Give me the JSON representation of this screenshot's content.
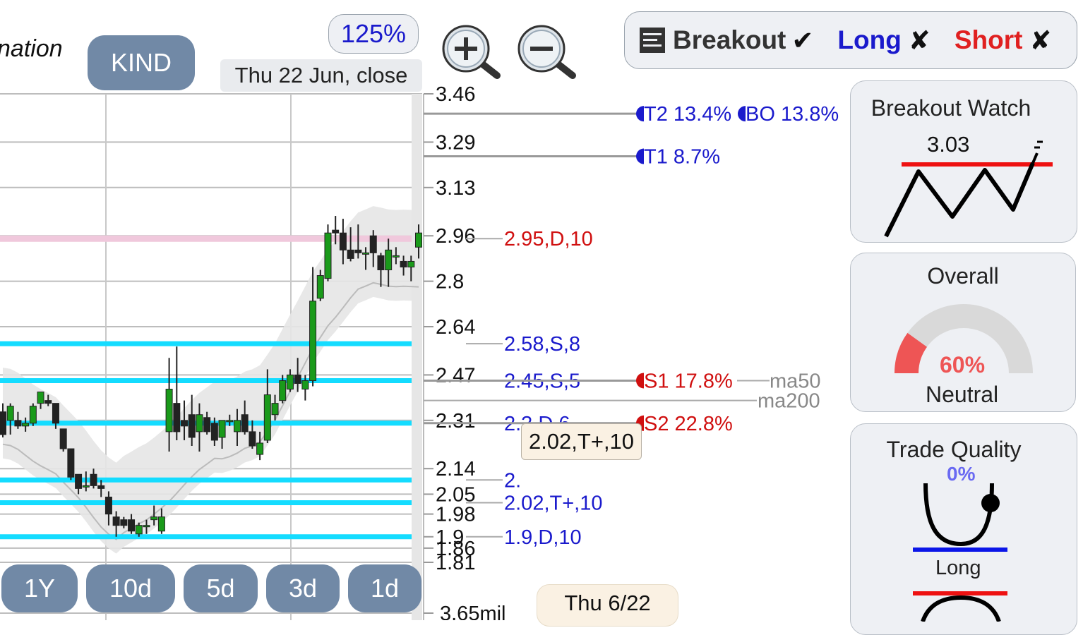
{
  "header": {
    "pattern_fragment": "nation",
    "ticker": "KIND",
    "zoom": "125%",
    "date_label": "Thu 22 Jun, close",
    "zoom_in_icon": "zoom-in-icon",
    "zoom_out_icon": "zoom-out-icon"
  },
  "mode_bar": {
    "icon": "document-icon",
    "breakout_label": "Breakout",
    "breakout_mark": "✔",
    "long_label": "Long",
    "long_mark": "✘",
    "short_label": "Short",
    "short_mark": "✘",
    "colors": {
      "long": "#1a1acc",
      "short": "#e02020"
    }
  },
  "periods": [
    "1Y",
    "10d",
    "5d",
    "3d",
    "1d"
  ],
  "tooltip": "2.02,T+,10",
  "date_box": "Thu 6/22",
  "panels": {
    "breakout_watch": {
      "title": "Breakout Watch",
      "value": "3.03"
    },
    "overall": {
      "title": "Overall",
      "value": "60%",
      "label": "Neutral",
      "fraction": 0.6
    },
    "trade_quality": {
      "title": "Trade Quality",
      "value": "0%",
      "label": "Long"
    }
  },
  "chart_data": {
    "type": "candlestick",
    "ylim": [
      1.78,
      3.5
    ],
    "price_ticks": [
      3.46,
      3.29,
      3.13,
      2.96,
      2.8,
      2.64,
      2.47,
      2.31,
      2.14,
      2.05,
      1.98,
      1.9,
      1.86,
      1.81
    ],
    "volume_label": "3.65mil",
    "resistance_line": 2.95,
    "support_bands": [
      2.58,
      2.45,
      2.3,
      2.1,
      2.02,
      1.9
    ],
    "level_labels": [
      {
        "price": 2.95,
        "text": "2.95,D,10",
        "color": "#d01010"
      },
      {
        "price": 2.58,
        "text": "2.58,S,8",
        "color": "#1a1acc"
      },
      {
        "price": 2.45,
        "text": "2.45,S,5",
        "color": "#1a1acc"
      },
      {
        "price": 2.3,
        "text": "2.3,D,6",
        "color": "#1a1acc"
      },
      {
        "price": 2.1,
        "text": "2.",
        "color": "#1a1acc"
      },
      {
        "price": 2.02,
        "text": "2.02,T+,10",
        "color": "#1a1acc"
      },
      {
        "price": 1.9,
        "text": "1.9,D,10",
        "color": "#1a1acc"
      }
    ],
    "targets": [
      {
        "price": 3.39,
        "text": "T2 13.4%",
        "color": "#1a1acc"
      },
      {
        "price": 3.39,
        "text": "BO 13.8%",
        "color": "#1a1acc"
      },
      {
        "price": 3.24,
        "text": "T1 8.7%",
        "color": "#1a1acc"
      },
      {
        "price": 2.45,
        "text": "S1 17.8%",
        "color": "#d01010"
      },
      {
        "price": 2.3,
        "text": "S2 22.8%",
        "color": "#d01010"
      }
    ],
    "moving_averages": [
      {
        "name": "ma50",
        "price": 2.45
      },
      {
        "name": "ma200",
        "price": 2.38
      }
    ],
    "candles": [
      {
        "o": 2.34,
        "h": 2.37,
        "l": 2.25,
        "c": 2.26
      },
      {
        "o": 2.31,
        "h": 2.37,
        "l": 2.26,
        "c": 2.36
      },
      {
        "o": 2.31,
        "h": 2.34,
        "l": 2.28,
        "c": 2.29
      },
      {
        "o": 2.29,
        "h": 2.32,
        "l": 2.27,
        "c": 2.3
      },
      {
        "o": 2.3,
        "h": 2.37,
        "l": 2.29,
        "c": 2.36
      },
      {
        "o": 2.37,
        "h": 2.41,
        "l": 2.35,
        "c": 2.41
      },
      {
        "o": 2.38,
        "h": 2.4,
        "l": 2.36,
        "c": 2.37
      },
      {
        "o": 2.37,
        "h": 2.37,
        "l": 2.28,
        "c": 2.3
      },
      {
        "o": 2.28,
        "h": 2.28,
        "l": 2.2,
        "c": 2.21
      },
      {
        "o": 2.21,
        "h": 2.21,
        "l": 2.1,
        "c": 2.11
      },
      {
        "o": 2.12,
        "h": 2.12,
        "l": 2.05,
        "c": 2.07
      },
      {
        "o": 2.08,
        "h": 2.13,
        "l": 2.06,
        "c": 2.08
      },
      {
        "o": 2.12,
        "h": 2.14,
        "l": 2.07,
        "c": 2.08
      },
      {
        "o": 2.08,
        "h": 2.1,
        "l": 2.04,
        "c": 2.07
      },
      {
        "o": 2.04,
        "h": 2.06,
        "l": 1.94,
        "c": 1.98
      },
      {
        "o": 1.97,
        "h": 1.99,
        "l": 1.9,
        "c": 1.94
      },
      {
        "o": 1.96,
        "h": 1.97,
        "l": 1.93,
        "c": 1.94
      },
      {
        "o": 1.96,
        "h": 1.98,
        "l": 1.91,
        "c": 1.92
      },
      {
        "o": 1.91,
        "h": 1.95,
        "l": 1.9,
        "c": 1.94
      },
      {
        "o": 1.94,
        "h": 1.96,
        "l": 1.91,
        "c": 1.94
      },
      {
        "o": 1.96,
        "h": 2.01,
        "l": 1.94,
        "c": 1.97
      },
      {
        "o": 1.92,
        "h": 2.0,
        "l": 1.91,
        "c": 1.97
      },
      {
        "o": 2.27,
        "h": 2.53,
        "l": 2.2,
        "c": 2.42
      },
      {
        "o": 2.37,
        "h": 2.57,
        "l": 2.24,
        "c": 2.27
      },
      {
        "o": 2.31,
        "h": 2.38,
        "l": 2.24,
        "c": 2.29
      },
      {
        "o": 2.33,
        "h": 2.4,
        "l": 2.22,
        "c": 2.25
      },
      {
        "o": 2.27,
        "h": 2.37,
        "l": 2.2,
        "c": 2.33
      },
      {
        "o": 2.32,
        "h": 2.34,
        "l": 2.26,
        "c": 2.27
      },
      {
        "o": 2.3,
        "h": 2.32,
        "l": 2.22,
        "c": 2.24
      },
      {
        "o": 2.25,
        "h": 2.31,
        "l": 2.21,
        "c": 2.31
      },
      {
        "o": 2.31,
        "h": 2.33,
        "l": 2.29,
        "c": 2.31
      },
      {
        "o": 2.27,
        "h": 2.35,
        "l": 2.22,
        "c": 2.31
      },
      {
        "o": 2.33,
        "h": 2.38,
        "l": 2.26,
        "c": 2.27
      },
      {
        "o": 2.27,
        "h": 2.31,
        "l": 2.21,
        "c": 2.22
      },
      {
        "o": 2.19,
        "h": 2.27,
        "l": 2.17,
        "c": 2.23
      },
      {
        "o": 2.24,
        "h": 2.49,
        "l": 2.23,
        "c": 2.4
      },
      {
        "o": 2.33,
        "h": 2.4,
        "l": 2.31,
        "c": 2.37
      },
      {
        "o": 2.38,
        "h": 2.47,
        "l": 2.37,
        "c": 2.45
      },
      {
        "o": 2.42,
        "h": 2.49,
        "l": 2.41,
        "c": 2.47
      },
      {
        "o": 2.47,
        "h": 2.53,
        "l": 2.41,
        "c": 2.44
      },
      {
        "o": 2.42,
        "h": 2.47,
        "l": 2.38,
        "c": 2.45
      },
      {
        "o": 2.45,
        "h": 2.85,
        "l": 2.43,
        "c": 2.73
      },
      {
        "o": 2.74,
        "h": 2.84,
        "l": 2.73,
        "c": 2.82
      },
      {
        "o": 2.81,
        "h": 3.0,
        "l": 2.8,
        "c": 2.97
      },
      {
        "o": 2.98,
        "h": 3.03,
        "l": 2.93,
        "c": 2.97
      },
      {
        "o": 2.97,
        "h": 3.02,
        "l": 2.86,
        "c": 2.91
      },
      {
        "o": 2.91,
        "h": 2.99,
        "l": 2.87,
        "c": 2.88
      },
      {
        "o": 2.91,
        "h": 3.0,
        "l": 2.88,
        "c": 2.9
      },
      {
        "o": 2.9,
        "h": 2.92,
        "l": 2.84,
        "c": 2.9
      },
      {
        "o": 2.96,
        "h": 2.98,
        "l": 2.85,
        "c": 2.9
      },
      {
        "o": 2.89,
        "h": 2.9,
        "l": 2.78,
        "c": 2.84
      },
      {
        "o": 2.84,
        "h": 2.95,
        "l": 2.78,
        "c": 2.91
      },
      {
        "o": 2.89,
        "h": 2.92,
        "l": 2.86,
        "c": 2.89
      },
      {
        "o": 2.87,
        "h": 2.89,
        "l": 2.82,
        "c": 2.85
      },
      {
        "o": 2.85,
        "h": 2.89,
        "l": 2.8,
        "c": 2.87
      },
      {
        "o": 2.92,
        "h": 3.0,
        "l": 2.88,
        "c": 2.97
      }
    ]
  }
}
